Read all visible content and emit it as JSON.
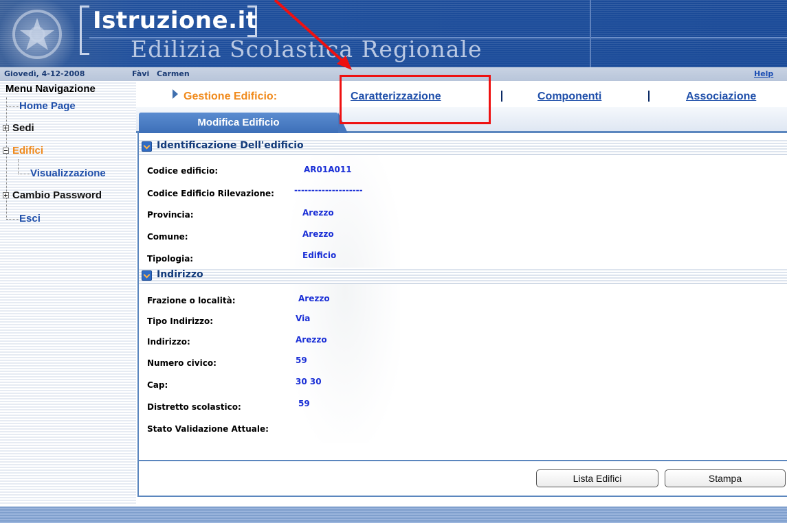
{
  "header": {
    "logo_title": "Istruzione.it",
    "logo_subtitle": "Edilizia Scolastica Regionale"
  },
  "infobar": {
    "date": "Giovedì, 4-12-2008",
    "user_last": "Fàvi",
    "user_first": "Carmen",
    "help": "Help"
  },
  "menu": {
    "title": "Menu Navigazione",
    "items": [
      {
        "label": "Home Page"
      },
      {
        "label": "Sedi"
      },
      {
        "label": "Edifici"
      },
      {
        "label": "Visualizzazione"
      },
      {
        "label": "Cambio Password"
      },
      {
        "label": "Esci"
      }
    ]
  },
  "nav": {
    "label": "Gestione Edificio:",
    "links": [
      {
        "label": "Caratterizzazione"
      },
      {
        "label": "Componenti"
      },
      {
        "label": "Associazione"
      }
    ]
  },
  "tab": {
    "active_label": "Modifica Edificio"
  },
  "sections": [
    {
      "title": "Identificazione Dell'edificio",
      "fields": [
        {
          "label": "Codice edificio:",
          "value": "AR01A011"
        },
        {
          "label": "Codice Edificio Rilevazione:",
          "value": "--------------------"
        },
        {
          "label": "Provincia:",
          "value": "Arezzo"
        },
        {
          "label": "Comune:",
          "value": "Arezzo"
        },
        {
          "label": "Tipologia:",
          "value": "Edificio"
        }
      ]
    },
    {
      "title": "Indirizzo",
      "fields": [
        {
          "label": "Frazione o località:",
          "value": "Arezzo"
        },
        {
          "label": "Tipo Indirizzo:",
          "value": "Via"
        },
        {
          "label": "Indirizzo:",
          "value": "Arezzo"
        },
        {
          "label": "Numero civico:",
          "value": "59"
        },
        {
          "label": "Cap:",
          "value": "30 30"
        },
        {
          "label": "Distretto scolastico:",
          "value": "59"
        },
        {
          "label": "Stato Validazione Attuale:",
          "value": ""
        }
      ]
    }
  ],
  "buttons": {
    "lista": "Lista Edifici",
    "stampa": "Stampa"
  },
  "colors": {
    "header_blue": "#1d4e9a",
    "link_blue": "#1f4faa",
    "accent_orange": "#f08a1c",
    "value_blue": "#1a2fd6",
    "annotation_red": "#ee1111"
  }
}
